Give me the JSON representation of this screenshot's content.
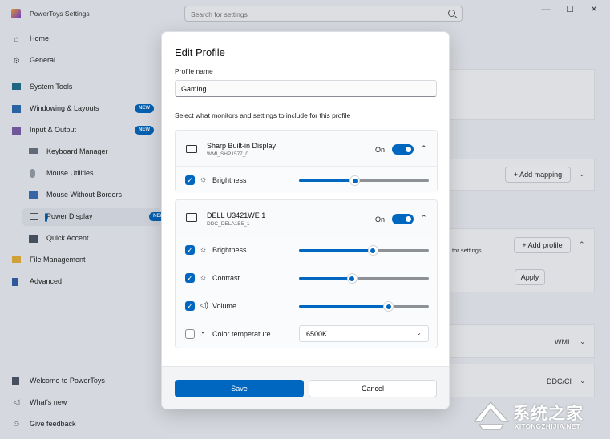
{
  "window": {
    "title": "PowerToys Settings",
    "search_placeholder": "Search for settings",
    "minimize": "—",
    "maximize": "☐",
    "close": "✕"
  },
  "sidebar": {
    "items": [
      {
        "label": "Home",
        "icon": "home-icon"
      },
      {
        "label": "General",
        "icon": "gear-icon"
      },
      {
        "label": "System Tools",
        "icon": "system-tools-icon"
      },
      {
        "label": "Windowing & Layouts",
        "icon": "windowing-icon",
        "badge": "NEW"
      },
      {
        "label": "Input & Output",
        "icon": "input-output-icon",
        "badge": "NEW"
      },
      {
        "label": "Keyboard Manager",
        "icon": "keyboard-icon"
      },
      {
        "label": "Mouse Utilities",
        "icon": "mouse-icon"
      },
      {
        "label": "Mouse Without Borders",
        "icon": "mouse-without-borders-icon"
      },
      {
        "label": "Power Display",
        "icon": "monitor-icon",
        "badge": "NEW",
        "selected": true
      },
      {
        "label": "Quick Accent",
        "icon": "quick-accent-icon"
      },
      {
        "label": "File Management",
        "icon": "folder-icon"
      },
      {
        "label": "Advanced",
        "icon": "advanced-icon"
      }
    ],
    "footer": [
      {
        "label": "Welcome to PowerToys",
        "icon": "welcome-icon"
      },
      {
        "label": "What's new",
        "icon": "whats-new-icon"
      },
      {
        "label": "Give feedback",
        "icon": "feedback-icon"
      }
    ]
  },
  "background": {
    "add_mapping": "+ Add mapping",
    "add_profile": "+ Add profile",
    "monitor_settings_fragment": "tor settings",
    "apply": "Apply",
    "more": "···",
    "wmi_value": "WMI",
    "ddc_value": "DDC/CI"
  },
  "dialog": {
    "title": "Edit Profile",
    "profile_name_label": "Profile name",
    "profile_name_value": "Gaming",
    "section_label": "Select what monitors and settings to include for this profile",
    "monitors": [
      {
        "name": "Sharp Built-in Display",
        "id": "WMI_SHP1577_0",
        "toggle_label": "On",
        "toggle_on": true,
        "settings": [
          {
            "label": "Brightness",
            "icon": "brightness-icon",
            "checked": true,
            "value_fraction": 0.43
          }
        ]
      },
      {
        "name": "DELL U3421WE 1",
        "id": "DDC_DELA1B5_1",
        "toggle_label": "On",
        "toggle_on": true,
        "settings": [
          {
            "label": "Brightness",
            "icon": "brightness-icon",
            "checked": true,
            "value_fraction": 0.57
          },
          {
            "label": "Contrast",
            "icon": "contrast-icon",
            "checked": true,
            "value_fraction": 0.41
          },
          {
            "label": "Volume",
            "icon": "volume-icon",
            "checked": true,
            "value_fraction": 0.69
          },
          {
            "label": "Color temperature",
            "icon": "color-temperature-icon",
            "checked": false,
            "select_value": "6500K"
          }
        ]
      }
    ],
    "save_label": "Save",
    "cancel_label": "Cancel"
  },
  "watermark": {
    "title": "系统之家",
    "url": "XITONGZHIJIA.NET"
  },
  "colors": {
    "accent": "#0067c0",
    "dialog_bg": "#ffffff",
    "page_bg": "#eef1f5"
  }
}
